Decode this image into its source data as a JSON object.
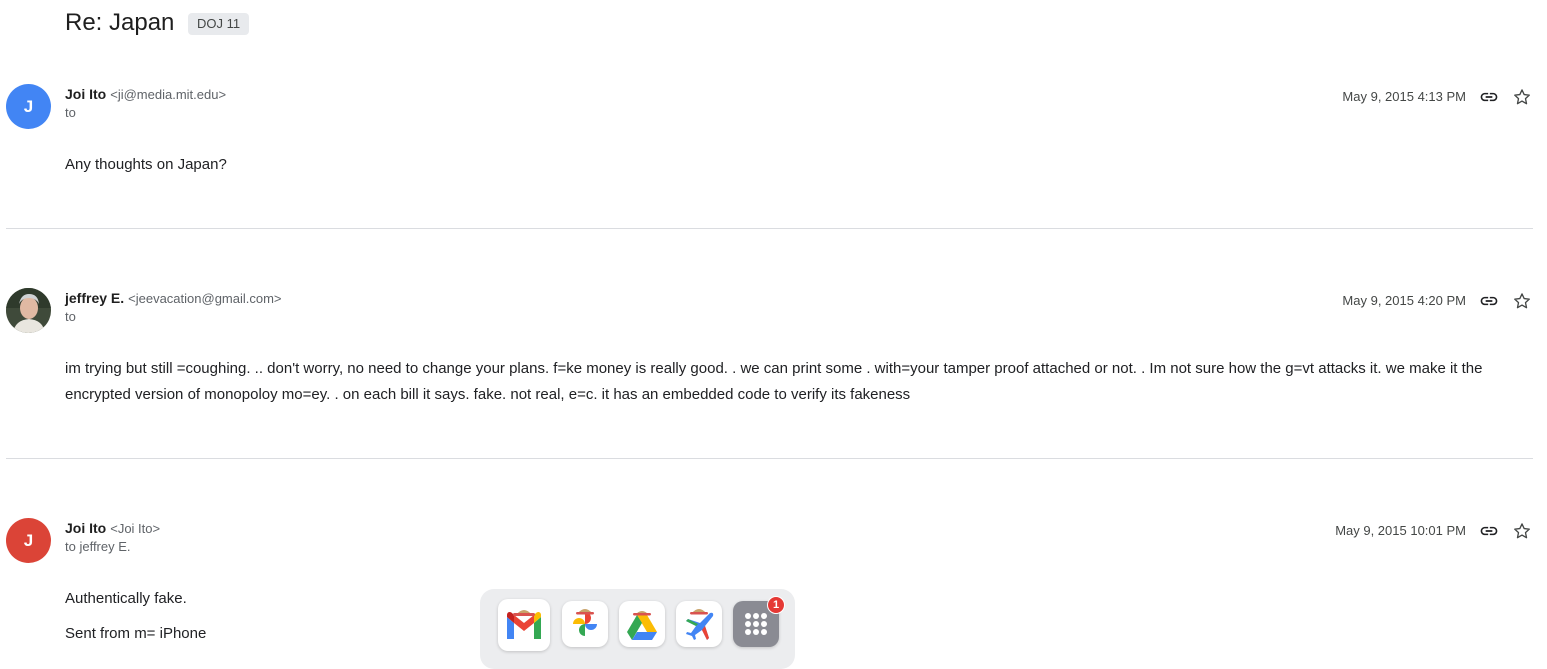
{
  "thread": {
    "subject": "Re: Japan",
    "label": "DOJ 11"
  },
  "messages": [
    {
      "avatar_letter": "J",
      "avatar_color": "#4285f4",
      "sender_name": "Joi Ito",
      "sender_email": "<ji@media.mit.edu>",
      "recipient": "to",
      "timestamp": "May 9, 2015 4:13 PM",
      "body": [
        "Any thoughts on Japan?"
      ]
    },
    {
      "avatar_letter": "",
      "avatar_color": "#5a6b4e",
      "sender_name": "jeffrey E.",
      "sender_email": "<jeevacation@gmail.com>",
      "recipient": "to",
      "timestamp": "May 9, 2015 4:20 PM",
      "body": [
        "im trying but still =coughing. .. don't worry, no need to change your plans. f=ke money is really good. . we can print some . with=your tamper proof attached or not. . Im not sure how the g=vt attacks it. we make it the encrypted version of monopoloy mo=ey. . on each bill it says. fake. not real, e=c. it has an embedded code to verify its fakeness"
      ]
    },
    {
      "avatar_letter": "J",
      "avatar_color": "#db4437",
      "sender_name": "Joi Ito",
      "sender_email": "<Joi Ito>",
      "recipient": "to jeffrey E.",
      "timestamp": "May 9, 2015 10:01 PM",
      "body": [
        "Authentically fake.",
        "Sent from m= iPhone"
      ]
    }
  ],
  "icons": {
    "link": "link-icon",
    "star": "star-icon"
  },
  "dock": {
    "apps": [
      "gmail-icon",
      "photos-icon",
      "drive-icon",
      "flights-icon",
      "app-launcher-icon"
    ],
    "launcher_badge": "1"
  }
}
